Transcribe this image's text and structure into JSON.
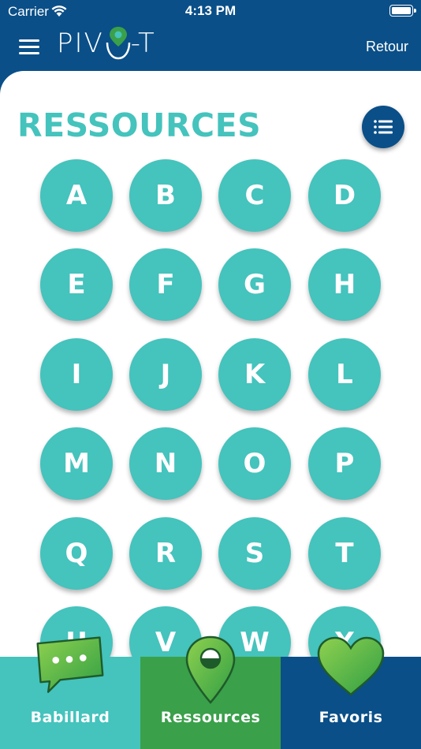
{
  "status_bar": {
    "carrier": "Carrier",
    "time": "4:13 PM"
  },
  "nav": {
    "logo_left": "PIV",
    "logo_right": "-T",
    "back_label": "Retour"
  },
  "page": {
    "title": "RESSOURCES"
  },
  "letters": [
    "A",
    "B",
    "C",
    "D",
    "E",
    "F",
    "G",
    "H",
    "I",
    "J",
    "K",
    "L",
    "M",
    "N",
    "O",
    "P",
    "Q",
    "R",
    "S",
    "T",
    "U",
    "V",
    "W",
    "X"
  ],
  "tabs": [
    {
      "label": "Babillard",
      "icon": "chat-bubble-icon"
    },
    {
      "label": "Ressources",
      "icon": "map-pin-icon"
    },
    {
      "label": "Favoris",
      "icon": "heart-icon"
    }
  ],
  "colors": {
    "primary_blue": "#0a4f88",
    "teal": "#45c3bd",
    "green": "#3aa04a"
  }
}
